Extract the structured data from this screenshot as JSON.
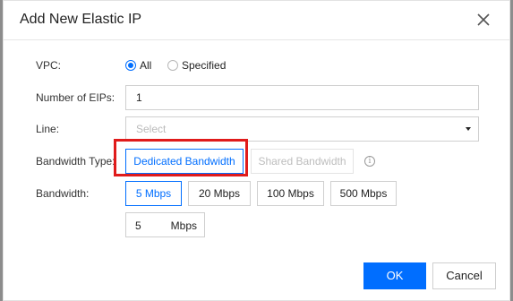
{
  "dialog": {
    "title": "Add New Elastic IP"
  },
  "form": {
    "vpc": {
      "label": "VPC:",
      "options": [
        "All",
        "Specified"
      ],
      "selected": "All"
    },
    "eip_count": {
      "label": "Number of EIPs:",
      "value": "1"
    },
    "line": {
      "label": "Line:",
      "placeholder": "Select"
    },
    "bandwidth_type": {
      "label": "Bandwidth Type:",
      "options": [
        "Dedicated Bandwidth",
        "Shared Bandwidth"
      ],
      "selected": "Dedicated Bandwidth"
    },
    "bandwidth": {
      "label": "Bandwidth:",
      "presets": [
        "5 Mbps",
        "20 Mbps",
        "100 Mbps",
        "500 Mbps"
      ],
      "selected": "5 Mbps",
      "value": "5",
      "unit": "Mbps"
    }
  },
  "footer": {
    "ok_label": "OK",
    "cancel_label": "Cancel"
  },
  "colors": {
    "accent": "#006eff",
    "highlight": "#e01b1b"
  },
  "icons": {
    "close": "close-icon",
    "info": "info-icon",
    "dropdown": "chevron-down-icon"
  }
}
